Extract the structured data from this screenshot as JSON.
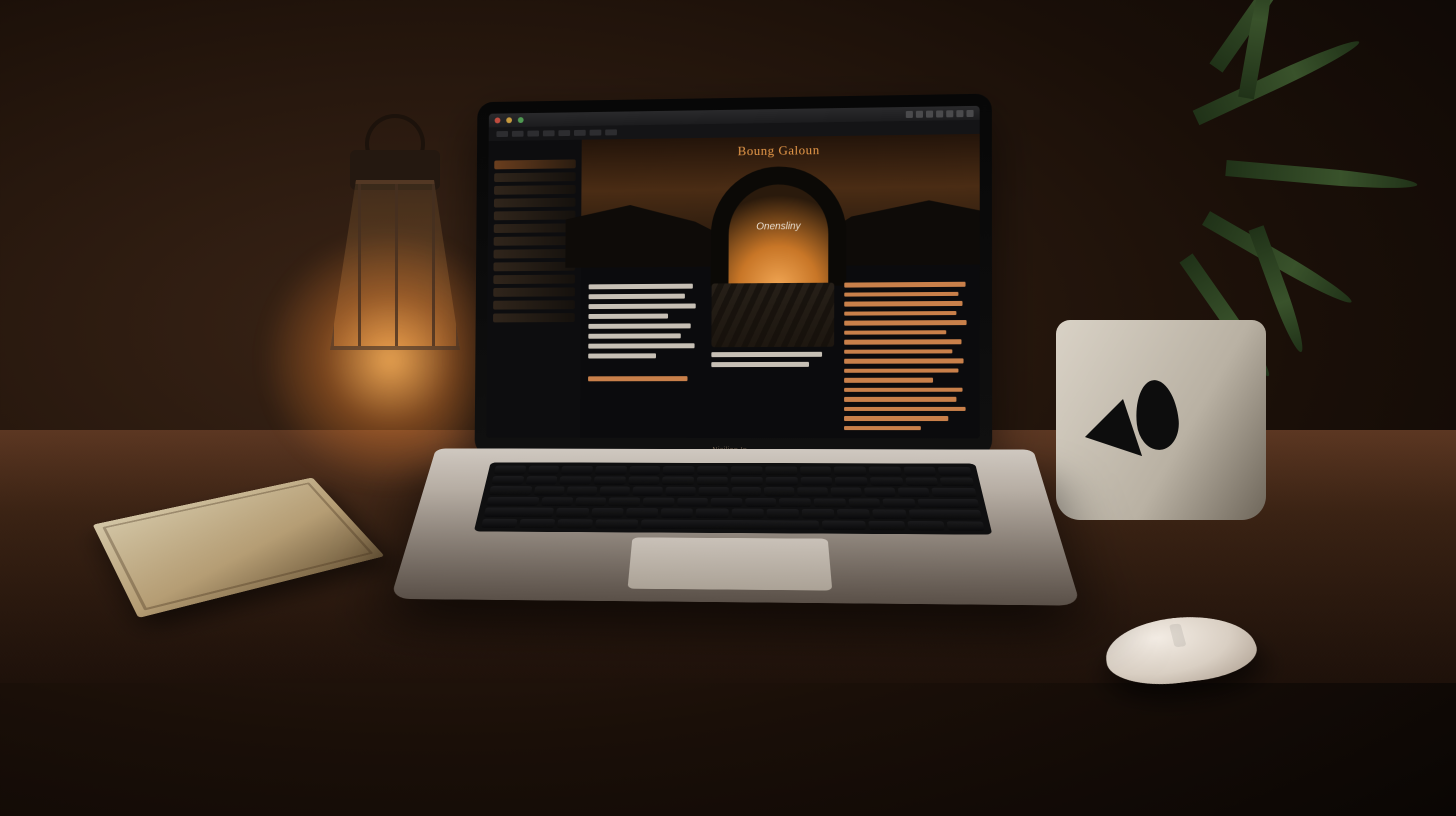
{
  "scene": {
    "description": "Photograph of a silver laptop on a wooden desk at dusk, lit by a small lantern. A potted plant, a wireless mouse and a notebook are also on the desk. The laptop screen shows a dark-themed website/editor.",
    "objects": [
      "laptop",
      "wireless-mouse",
      "lantern",
      "potted-plant",
      "notebook",
      "wooden-desk"
    ]
  },
  "laptop": {
    "bezel_label": "Nisilion In"
  },
  "screen": {
    "page_title": "Boung Galoun",
    "page_subtitle": "",
    "brand_overlay": "Onensliny",
    "accent_color": "#e0935a",
    "sidebar": {
      "sections": [
        {
          "label": "",
          "items": [
            "",
            "",
            "",
            "",
            "",
            "",
            "",
            "",
            "",
            "",
            "",
            "",
            ""
          ]
        }
      ],
      "active_index": 0
    },
    "columns": {
      "left": {
        "heading": "",
        "lines": 10
      },
      "mid": {
        "heading": "",
        "has_thumbnail": true
      },
      "right": {
        "heading": "",
        "lines": 16
      }
    }
  }
}
